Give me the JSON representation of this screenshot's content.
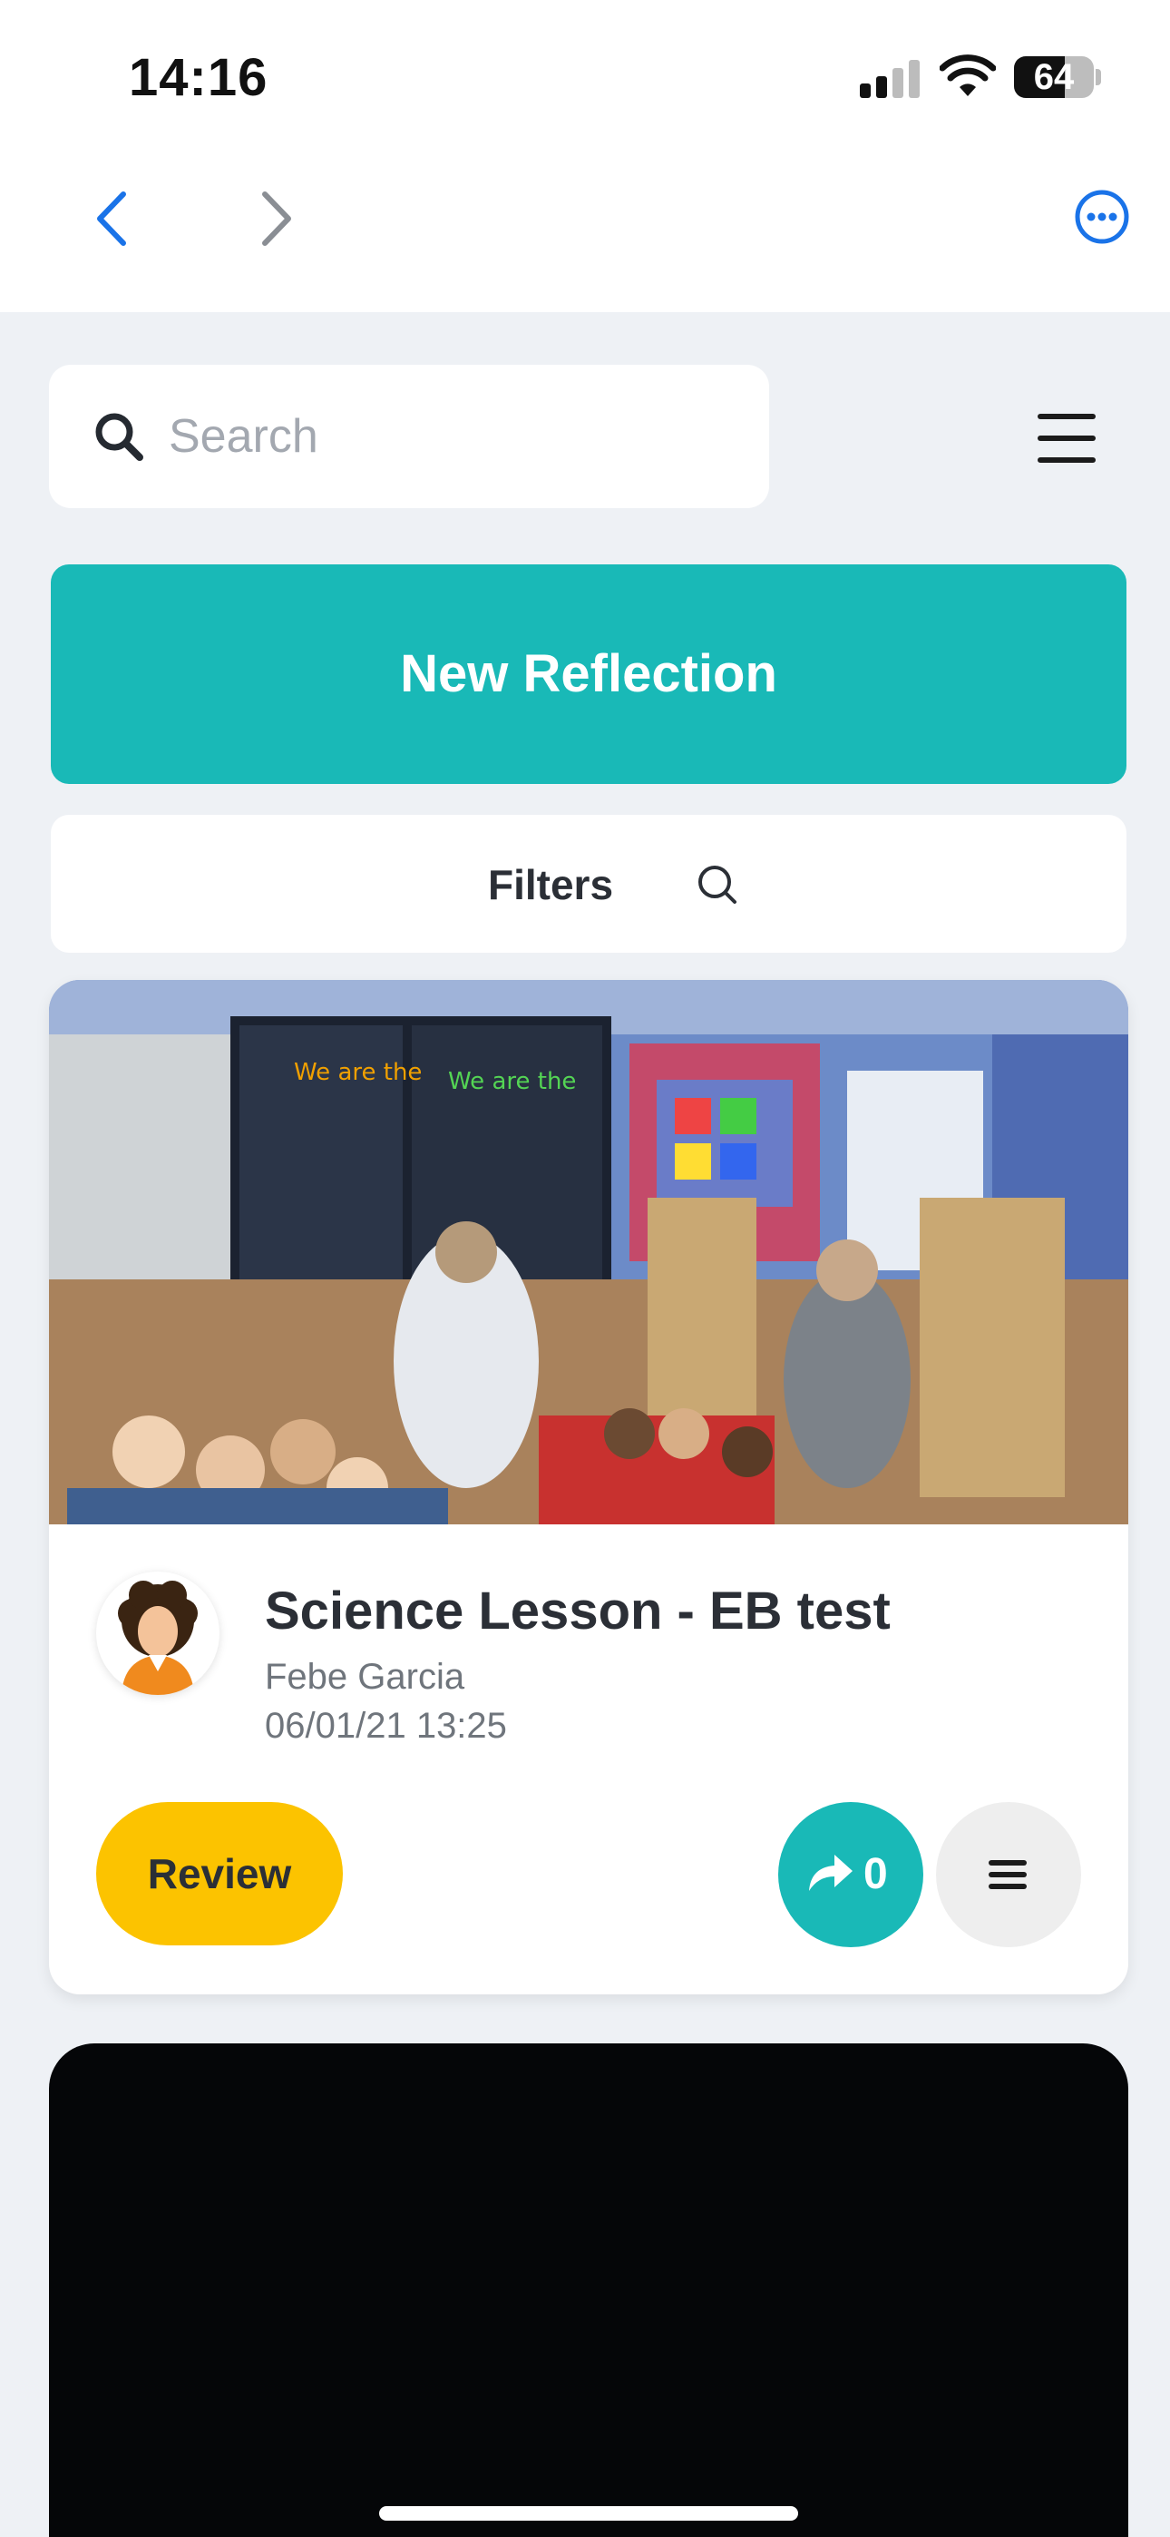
{
  "status_bar": {
    "time": "14:16",
    "battery_percent": "64",
    "signal_icon": "cellular-signal-icon",
    "wifi_icon": "wifi-icon"
  },
  "nav": {
    "back_icon": "chevron-left-icon",
    "forward_icon": "chevron-right-icon",
    "more_icon": "more-options-icon",
    "accent_color": "#1a73e8"
  },
  "search": {
    "placeholder": "Search",
    "value": ""
  },
  "new_reflection": {
    "label": "New Reflection",
    "color": "#19b9b7"
  },
  "filters": {
    "label": "Filters",
    "icon": "search-icon"
  },
  "reflection_card": {
    "media": "classroom-photo",
    "avatar": "teacher-avatar",
    "title": "Science Lesson - EB test",
    "author": "Febe Garcia",
    "date": "06/01/21 13:25",
    "review_label": "Review",
    "review_color": "#fcc300",
    "share_count": "0",
    "share_icon": "share-arrow-icon",
    "menu_icon": "hamburger-menu-icon"
  },
  "second_card": {
    "media": "video-thumbnail-black"
  }
}
